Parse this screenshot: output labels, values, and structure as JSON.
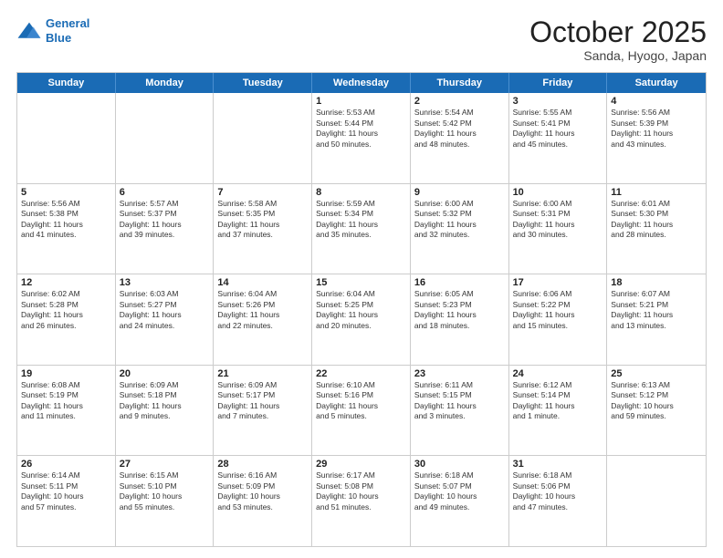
{
  "header": {
    "logo_general": "General",
    "logo_blue": "Blue",
    "month": "October 2025",
    "location": "Sanda, Hyogo, Japan"
  },
  "days_of_week": [
    "Sunday",
    "Monday",
    "Tuesday",
    "Wednesday",
    "Thursday",
    "Friday",
    "Saturday"
  ],
  "weeks": [
    [
      {
        "day": "",
        "text": ""
      },
      {
        "day": "",
        "text": ""
      },
      {
        "day": "",
        "text": ""
      },
      {
        "day": "1",
        "text": "Sunrise: 5:53 AM\nSunset: 5:44 PM\nDaylight: 11 hours\nand 50 minutes."
      },
      {
        "day": "2",
        "text": "Sunrise: 5:54 AM\nSunset: 5:42 PM\nDaylight: 11 hours\nand 48 minutes."
      },
      {
        "day": "3",
        "text": "Sunrise: 5:55 AM\nSunset: 5:41 PM\nDaylight: 11 hours\nand 45 minutes."
      },
      {
        "day": "4",
        "text": "Sunrise: 5:56 AM\nSunset: 5:39 PM\nDaylight: 11 hours\nand 43 minutes."
      }
    ],
    [
      {
        "day": "5",
        "text": "Sunrise: 5:56 AM\nSunset: 5:38 PM\nDaylight: 11 hours\nand 41 minutes."
      },
      {
        "day": "6",
        "text": "Sunrise: 5:57 AM\nSunset: 5:37 PM\nDaylight: 11 hours\nand 39 minutes."
      },
      {
        "day": "7",
        "text": "Sunrise: 5:58 AM\nSunset: 5:35 PM\nDaylight: 11 hours\nand 37 minutes."
      },
      {
        "day": "8",
        "text": "Sunrise: 5:59 AM\nSunset: 5:34 PM\nDaylight: 11 hours\nand 35 minutes."
      },
      {
        "day": "9",
        "text": "Sunrise: 6:00 AM\nSunset: 5:32 PM\nDaylight: 11 hours\nand 32 minutes."
      },
      {
        "day": "10",
        "text": "Sunrise: 6:00 AM\nSunset: 5:31 PM\nDaylight: 11 hours\nand 30 minutes."
      },
      {
        "day": "11",
        "text": "Sunrise: 6:01 AM\nSunset: 5:30 PM\nDaylight: 11 hours\nand 28 minutes."
      }
    ],
    [
      {
        "day": "12",
        "text": "Sunrise: 6:02 AM\nSunset: 5:28 PM\nDaylight: 11 hours\nand 26 minutes."
      },
      {
        "day": "13",
        "text": "Sunrise: 6:03 AM\nSunset: 5:27 PM\nDaylight: 11 hours\nand 24 minutes."
      },
      {
        "day": "14",
        "text": "Sunrise: 6:04 AM\nSunset: 5:26 PM\nDaylight: 11 hours\nand 22 minutes."
      },
      {
        "day": "15",
        "text": "Sunrise: 6:04 AM\nSunset: 5:25 PM\nDaylight: 11 hours\nand 20 minutes."
      },
      {
        "day": "16",
        "text": "Sunrise: 6:05 AM\nSunset: 5:23 PM\nDaylight: 11 hours\nand 18 minutes."
      },
      {
        "day": "17",
        "text": "Sunrise: 6:06 AM\nSunset: 5:22 PM\nDaylight: 11 hours\nand 15 minutes."
      },
      {
        "day": "18",
        "text": "Sunrise: 6:07 AM\nSunset: 5:21 PM\nDaylight: 11 hours\nand 13 minutes."
      }
    ],
    [
      {
        "day": "19",
        "text": "Sunrise: 6:08 AM\nSunset: 5:19 PM\nDaylight: 11 hours\nand 11 minutes."
      },
      {
        "day": "20",
        "text": "Sunrise: 6:09 AM\nSunset: 5:18 PM\nDaylight: 11 hours\nand 9 minutes."
      },
      {
        "day": "21",
        "text": "Sunrise: 6:09 AM\nSunset: 5:17 PM\nDaylight: 11 hours\nand 7 minutes."
      },
      {
        "day": "22",
        "text": "Sunrise: 6:10 AM\nSunset: 5:16 PM\nDaylight: 11 hours\nand 5 minutes."
      },
      {
        "day": "23",
        "text": "Sunrise: 6:11 AM\nSunset: 5:15 PM\nDaylight: 11 hours\nand 3 minutes."
      },
      {
        "day": "24",
        "text": "Sunrise: 6:12 AM\nSunset: 5:14 PM\nDaylight: 11 hours\nand 1 minute."
      },
      {
        "day": "25",
        "text": "Sunrise: 6:13 AM\nSunset: 5:12 PM\nDaylight: 10 hours\nand 59 minutes."
      }
    ],
    [
      {
        "day": "26",
        "text": "Sunrise: 6:14 AM\nSunset: 5:11 PM\nDaylight: 10 hours\nand 57 minutes."
      },
      {
        "day": "27",
        "text": "Sunrise: 6:15 AM\nSunset: 5:10 PM\nDaylight: 10 hours\nand 55 minutes."
      },
      {
        "day": "28",
        "text": "Sunrise: 6:16 AM\nSunset: 5:09 PM\nDaylight: 10 hours\nand 53 minutes."
      },
      {
        "day": "29",
        "text": "Sunrise: 6:17 AM\nSunset: 5:08 PM\nDaylight: 10 hours\nand 51 minutes."
      },
      {
        "day": "30",
        "text": "Sunrise: 6:18 AM\nSunset: 5:07 PM\nDaylight: 10 hours\nand 49 minutes."
      },
      {
        "day": "31",
        "text": "Sunrise: 6:18 AM\nSunset: 5:06 PM\nDaylight: 10 hours\nand 47 minutes."
      },
      {
        "day": "",
        "text": ""
      }
    ]
  ]
}
